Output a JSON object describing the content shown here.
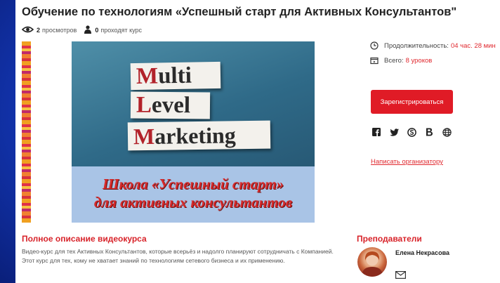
{
  "course": {
    "title": "Обучение по технологиям «Успешный старт для Активных Консультантов\"",
    "views_count": "2",
    "views_label": "просмотров",
    "students_count": "0",
    "students_label": "проходят курс"
  },
  "promo": {
    "word1_cap": "M",
    "word1_rest": "ulti",
    "word2_cap": "L",
    "word2_rest": "evel",
    "word3_cap": "M",
    "word3_rest": "arketing",
    "banner_line1": "Школа «Успешный старт»",
    "banner_line2": "для активных консультантов"
  },
  "sidebar": {
    "duration_label": "Продолжительность:",
    "duration_value": "04 час. 28 мин",
    "total_label": "Всего:",
    "total_value": "8 уроков",
    "register_label": "Зарегистрироваться",
    "write_organizer": "Написать организатору",
    "social_icons": [
      "facebook-icon",
      "twitter-icon",
      "skype-icon",
      "vk-icon",
      "globe-icon"
    ]
  },
  "description": {
    "heading": "Полное описание видеокурса",
    "text": "Видео-курс для тех Активных Консультантов, которые всерьёз и надолго планируют сотрудничать с Компанией. Этот курс для тех, кому не хватает знаний по технологиям сетевого бизнеса и их применению."
  },
  "teachers": {
    "heading": "Преподаватели",
    "name": "Елена Некрасова"
  },
  "colors": {
    "accent": "#e01b26",
    "background": "#1e4fd4"
  }
}
